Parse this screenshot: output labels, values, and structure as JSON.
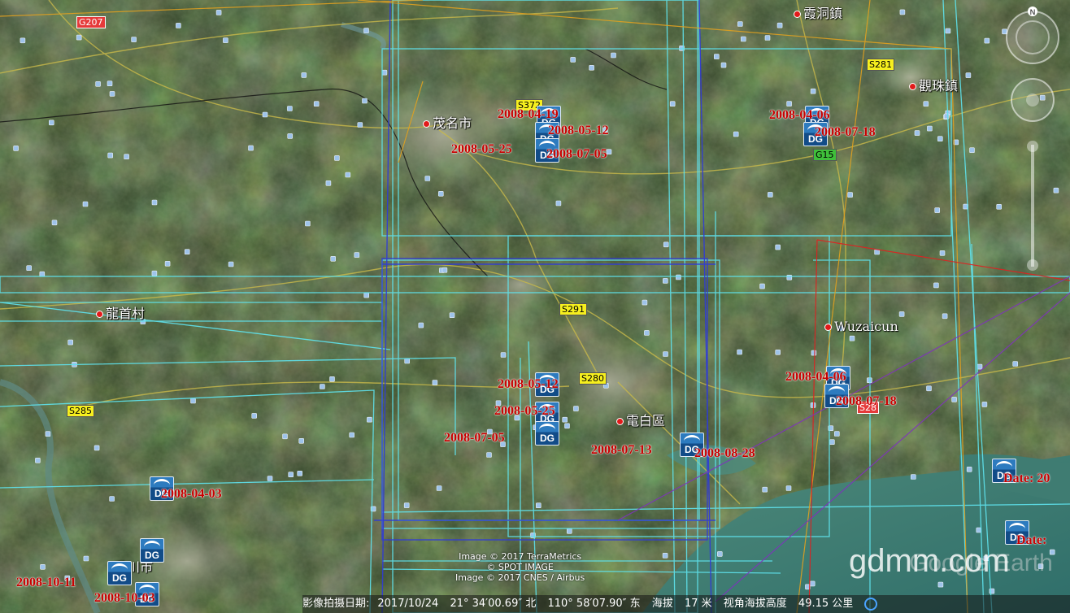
{
  "map": {
    "places": [
      {
        "id": "xiadong",
        "name": "霞洞鎮"
      },
      {
        "id": "guanzhu",
        "name": "觀珠鎮"
      },
      {
        "id": "maoming",
        "name": "茂名市"
      },
      {
        "id": "longshou",
        "name": "龍首村"
      },
      {
        "id": "wuzaicun",
        "name": "Wuzaicun"
      },
      {
        "id": "dianbai",
        "name": "電白區"
      },
      {
        "id": "wuchuan",
        "name": "吳川市"
      }
    ],
    "road_signs": [
      {
        "id": "g207",
        "label": "G207",
        "style": "red"
      },
      {
        "id": "s281",
        "label": "S281",
        "style": "yellow"
      },
      {
        "id": "s372",
        "label": "S372",
        "style": "yellow"
      },
      {
        "id": "g15",
        "label": "G15",
        "style": "green"
      },
      {
        "id": "s291",
        "label": "S291",
        "style": "yellow"
      },
      {
        "id": "s280",
        "label": "S280",
        "style": "yellow"
      },
      {
        "id": "s285",
        "label": "S285",
        "style": "yellow"
      },
      {
        "id": "s28x",
        "label": "S28",
        "style": "red"
      }
    ],
    "dg_icon_label": "DG",
    "dates": [
      {
        "id": "d1",
        "text": "2008-04-19"
      },
      {
        "id": "d2",
        "text": "2008-05-12"
      },
      {
        "id": "d3",
        "text": "2008-05-25"
      },
      {
        "id": "d4",
        "text": "2008-07-05"
      },
      {
        "id": "d5",
        "text": "2008-04-06"
      },
      {
        "id": "d6",
        "text": "2008-07-18"
      },
      {
        "id": "d7",
        "text": "2008-05-12"
      },
      {
        "id": "d8",
        "text": "2008-05-25"
      },
      {
        "id": "d9",
        "text": "2008-07-05"
      },
      {
        "id": "d10",
        "text": "2008-07-13"
      },
      {
        "id": "d11",
        "text": "2008-08-28"
      },
      {
        "id": "d12",
        "text": "2008-04-06"
      },
      {
        "id": "d13",
        "text": "2008-07-18"
      },
      {
        "id": "d14",
        "text": "2008-04-03"
      },
      {
        "id": "d15",
        "text": "2008-10-11"
      },
      {
        "id": "d16",
        "text": "2008-10-03"
      },
      {
        "id": "d17",
        "text": "Date: 20"
      },
      {
        "id": "d18",
        "text": "Date:"
      }
    ],
    "copyright": {
      "line1": "Image © 2017 TerraMetrics",
      "line2": "© SPOT IMAGE",
      "line3": "Image © 2017 CNES / Airbus"
    },
    "watermark": "gdmm.com",
    "watermark_product": "Google Earth",
    "compass_label": "N"
  },
  "statusbar": {
    "imagery_date_label": "影像拍摄日期:",
    "imagery_date": "2017/10/24",
    "lat": "21° 34′00.69″ 北",
    "lon": "110° 58′07.90″ 东",
    "elevation_label": "海拔",
    "elevation": "17 米",
    "eye_alt_label": "视角海拔高度",
    "eye_alt": "49.15 公里"
  },
  "colors": {
    "footprint_cyan": "#5fe3ee",
    "footprint_blue": "#2f3bd8",
    "footprint_orange": "#e0a020",
    "footprint_red": "#e02020",
    "date_red": "#c80000"
  }
}
